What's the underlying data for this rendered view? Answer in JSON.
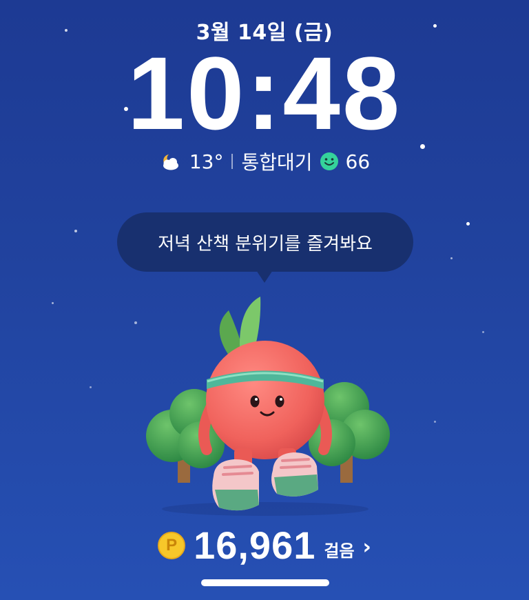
{
  "lockscreen": {
    "date": "3월 14일 (금)",
    "time": "10:48",
    "weather": {
      "icon": "partly-cloudy-night-icon",
      "temperature": "13°",
      "air_label": "통합대기",
      "air_icon": "smile-face-icon",
      "air_value": "66",
      "air_color": "#35d39b"
    },
    "speech": "저녁 산책 분위기를 즐겨봐요",
    "steps": {
      "coin_label": "P",
      "count": "16,961",
      "unit": "걸음",
      "chevron": "›"
    }
  }
}
